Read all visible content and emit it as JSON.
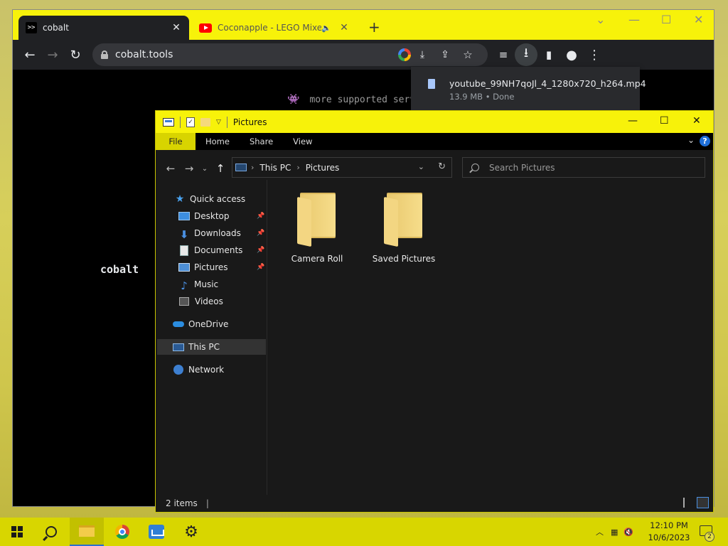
{
  "browser": {
    "tabs": [
      {
        "title": "cobalt",
        "favicon": ">>",
        "active": true
      },
      {
        "title": "Coconapple - LEGO Mixels",
        "favicon": "youtube-icon",
        "active": false
      }
    ],
    "new_tab_label": "+",
    "url": "cobalt.tools",
    "page": {
      "supported_text": "more supported serv",
      "logo_text": "cobalt"
    },
    "download": {
      "filename": "youtube_99NH7qoJl_4_1280x720_h264.mp4",
      "meta": "13.9 MB • Done"
    },
    "frame_color": "#f7f20a"
  },
  "explorer": {
    "title": "Pictures",
    "ribbon_tabs": [
      "File",
      "Home",
      "Share",
      "View"
    ],
    "breadcrumb": [
      "This PC",
      "Pictures"
    ],
    "search_placeholder": "Search Pictures",
    "nav_pane": {
      "quick_access": "Quick access",
      "items": [
        "Desktop",
        "Downloads",
        "Documents",
        "Pictures",
        "Music",
        "Videos"
      ],
      "onedrive": "OneDrive",
      "this_pc": "This PC",
      "network": "Network"
    },
    "folders": [
      "Camera Roll",
      "Saved Pictures"
    ],
    "status": "2 items"
  },
  "taskbar": {
    "time": "12:10 PM",
    "date": "10/6/2023",
    "notification_count": "2",
    "color": "#d8d600"
  }
}
